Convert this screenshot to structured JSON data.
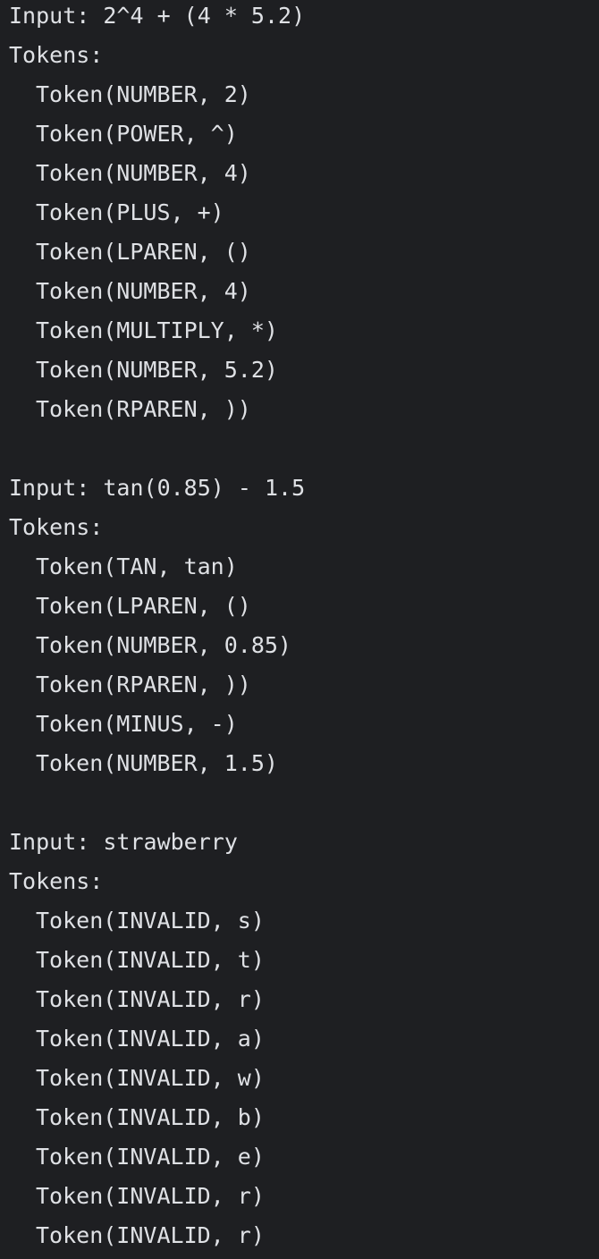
{
  "console": {
    "blocks": [
      {
        "input": "Input: 2^4 + (4 * 5.2)",
        "tokens_label": "Tokens:",
        "tokens": [
          "Token(NUMBER, 2)",
          "Token(POWER, ^)",
          "Token(NUMBER, 4)",
          "Token(PLUS, +)",
          "Token(LPAREN, ()",
          "Token(NUMBER, 4)",
          "Token(MULTIPLY, *)",
          "Token(NUMBER, 5.2)",
          "Token(RPAREN, ))"
        ]
      },
      {
        "input": "Input: tan(0.85) - 1.5",
        "tokens_label": "Tokens:",
        "tokens": [
          "Token(TAN, tan)",
          "Token(LPAREN, ()",
          "Token(NUMBER, 0.85)",
          "Token(RPAREN, ))",
          "Token(MINUS, -)",
          "Token(NUMBER, 1.5)"
        ]
      },
      {
        "input": "Input: strawberry",
        "tokens_label": "Tokens:",
        "tokens": [
          "Token(INVALID, s)",
          "Token(INVALID, t)",
          "Token(INVALID, r)",
          "Token(INVALID, a)",
          "Token(INVALID, w)",
          "Token(INVALID, b)",
          "Token(INVALID, e)",
          "Token(INVALID, r)",
          "Token(INVALID, r)"
        ]
      }
    ]
  }
}
